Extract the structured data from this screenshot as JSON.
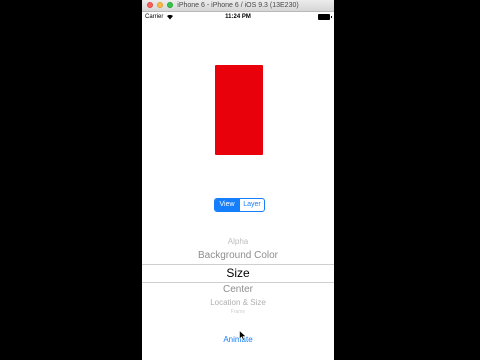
{
  "simulator": {
    "title": "iPhone 6 - iPhone 6 / iOS 9.3 (13E230)"
  },
  "status_bar": {
    "carrier": "Carrier",
    "time": "11:24 PM",
    "icons": [
      "wifi-icon",
      "battery-icon"
    ]
  },
  "preview": {
    "color": "#e8000b"
  },
  "segmented_control": {
    "segments": [
      "View",
      "Layer"
    ],
    "selected": "View",
    "accent_color": "#157efb"
  },
  "picker": {
    "items": [
      "Alpha",
      "Background Color",
      "Size",
      "Center",
      "Location & Size"
    ],
    "partial_item": "Frame",
    "selected": "Size"
  },
  "animate_button": {
    "label": "Animate"
  }
}
